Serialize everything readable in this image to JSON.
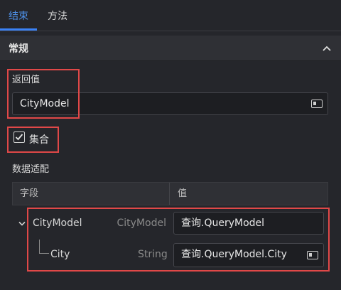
{
  "tabs": [
    {
      "label": "结束",
      "active": true
    },
    {
      "label": "方法",
      "active": false
    }
  ],
  "section": {
    "title": "常规"
  },
  "return_value": {
    "label": "返回值",
    "value": "CityModel"
  },
  "collection": {
    "label": "集合",
    "checked": true
  },
  "data_mapping": {
    "label": "数据适配",
    "columns": [
      "字段",
      "值"
    ],
    "rows": [
      {
        "name": "CityModel",
        "type": "CityModel",
        "value": "查询.QueryModel"
      },
      {
        "name": "City",
        "type": "String",
        "value": "查询.QueryModel.City"
      }
    ]
  },
  "colors": {
    "accent": "#3b82f6",
    "highlight": "#e04848",
    "background": "#25262b"
  }
}
